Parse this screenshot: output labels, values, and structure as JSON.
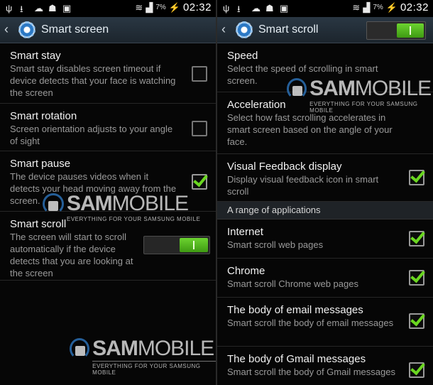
{
  "status_bar": {
    "time": "02:32",
    "battery": "7%",
    "icons": [
      "usb-icon",
      "download-icon",
      "cloud-icon",
      "android-icon",
      "sd-card-icon",
      "wifi-icon",
      "signal-icon",
      "battery-charging-icon"
    ]
  },
  "left": {
    "title": "Smart screen",
    "items": [
      {
        "title": "Smart stay",
        "desc": "Smart stay disables screen timeout if device detects that your face is watching the screen",
        "control": "checkbox",
        "checked": false
      },
      {
        "title": "Smart rotation",
        "desc": "Screen orientation adjusts to your angle of sight",
        "control": "checkbox",
        "checked": false
      },
      {
        "title": "Smart pause",
        "desc": "The device pauses videos when it detects your head moving away from the screen.",
        "control": "checkbox",
        "checked": true
      },
      {
        "title": "Smart scroll",
        "desc": "The screen will start to scroll automatically if the device detects that you are looking at the screen",
        "control": "toggle",
        "on": true
      }
    ]
  },
  "right": {
    "title": "Smart scroll",
    "master_toggle_on": true,
    "items": [
      {
        "title": "Speed",
        "desc": "Select the speed of scrolling in smart screen."
      },
      {
        "title": "Acceleration",
        "desc": "Select how fast scrolling accelerates in smart screen based on the angle of your face."
      },
      {
        "title": "Visual Feedback display",
        "desc": "Display visual feedback icon in smart scroll",
        "checked": true
      }
    ],
    "section_header": "A range of applications",
    "apps": [
      {
        "title": "Internet",
        "desc": "Smart scroll web pages",
        "checked": true
      },
      {
        "title": "Chrome",
        "desc": "Smart scroll Chrome web pages",
        "checked": true
      },
      {
        "title": "The body of email messages",
        "desc": "Smart scroll the body of email messages",
        "checked": true
      },
      {
        "title": "The body of Gmail messages",
        "desc": "Smart scroll the body of Gmail messages",
        "checked": true
      }
    ]
  },
  "watermark": {
    "brand_bold": "SAM",
    "brand_thin": "MOBILE",
    "tagline": "EVERYTHING FOR YOUR SAMSUNG MOBILE"
  },
  "colors": {
    "accent_green": "#6ad620",
    "action_bar": "#2a3743",
    "brand_blue": "#2b6fb3"
  }
}
